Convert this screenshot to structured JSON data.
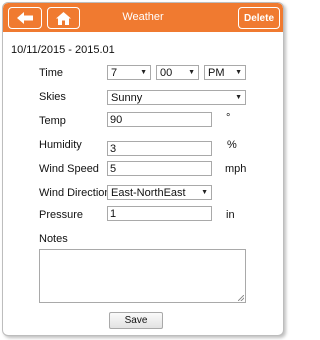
{
  "header": {
    "title": "Weather",
    "delete_label": "Delete",
    "back_icon": "arrow-left-icon",
    "home_icon": "home-icon",
    "color": "#f07a30"
  },
  "record": {
    "date_range": "10/11/2015 - 2015.01"
  },
  "form": {
    "time_label": "Time",
    "time_hour": "7",
    "time_minute": "00",
    "time_ampm": "PM",
    "skies_label": "Skies",
    "skies_value": "Sunny",
    "temp_label": "Temp",
    "temp_value": "90",
    "temp_unit": "°",
    "humidity_label": "Humidity",
    "humidity_value": "3",
    "humidity_unit": "%",
    "wind_speed_label": "Wind Speed",
    "wind_speed_value": "5",
    "wind_speed_unit": "mph",
    "wind_direction_label": "Wind Direction",
    "wind_direction_value": "East-NorthEast",
    "pressure_label": "Pressure",
    "pressure_value": "1",
    "pressure_unit": "in",
    "notes_label": "Notes",
    "notes_value": ""
  },
  "actions": {
    "save_label": "Save"
  }
}
